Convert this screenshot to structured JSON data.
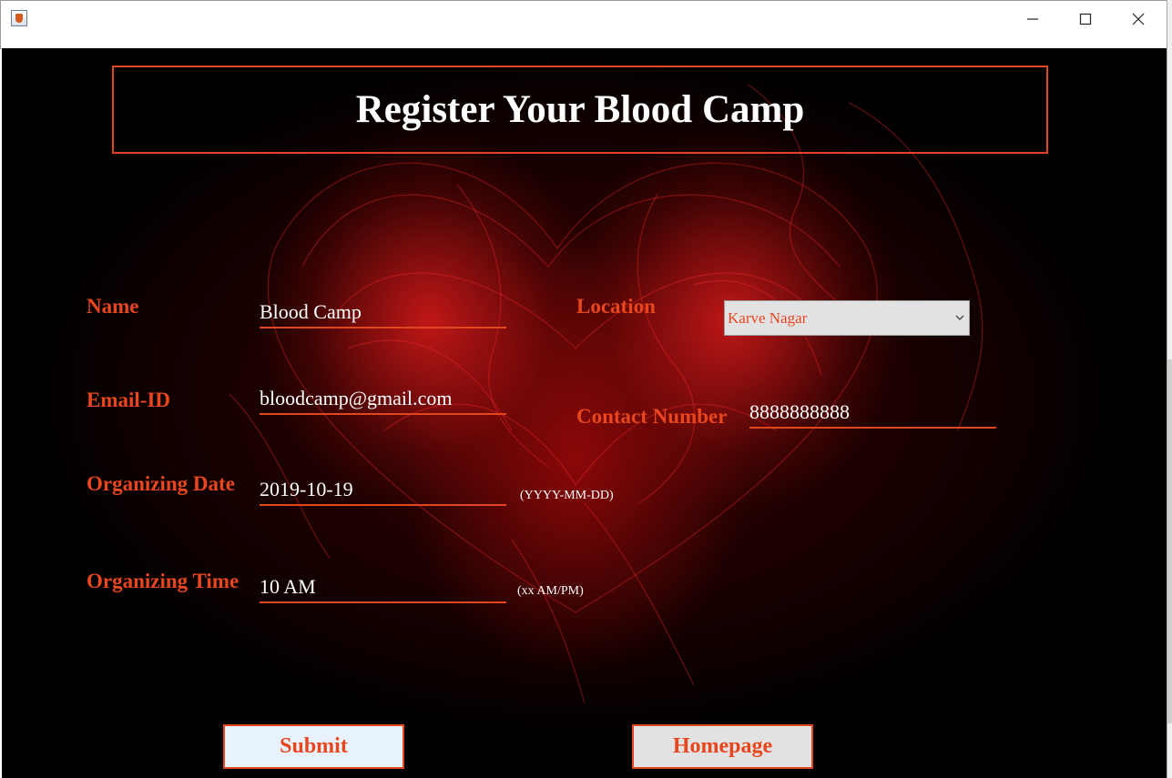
{
  "window": {
    "icon": "java-cup-icon",
    "controls": {
      "minimize": "minimize-icon",
      "maximize": "maximize-icon",
      "close": "close-icon"
    }
  },
  "form": {
    "title": "Register Your Blood Camp",
    "name": {
      "label": "Name",
      "value": "Blood Camp"
    },
    "location": {
      "label": "Location",
      "value": "Karve Nagar"
    },
    "email": {
      "label": "Email-ID",
      "value": "bloodcamp@gmail.com"
    },
    "contact": {
      "label": "Contact Number",
      "value": "8888888888"
    },
    "date": {
      "label": "Organizing Date",
      "value": "2019-10-19",
      "hint": "(YYYY-MM-DD)"
    },
    "time": {
      "label": "Organizing Time",
      "value": "10 AM",
      "hint": "(xx AM/PM)"
    }
  },
  "buttons": {
    "submit": "Submit",
    "homepage": "Homepage"
  },
  "colors": {
    "accent": "#e8461e",
    "title_text": "#ffffff",
    "background": "#2a0000",
    "submit_bg": "#e7f2fb",
    "homepage_bg": "#e2e2e2"
  }
}
